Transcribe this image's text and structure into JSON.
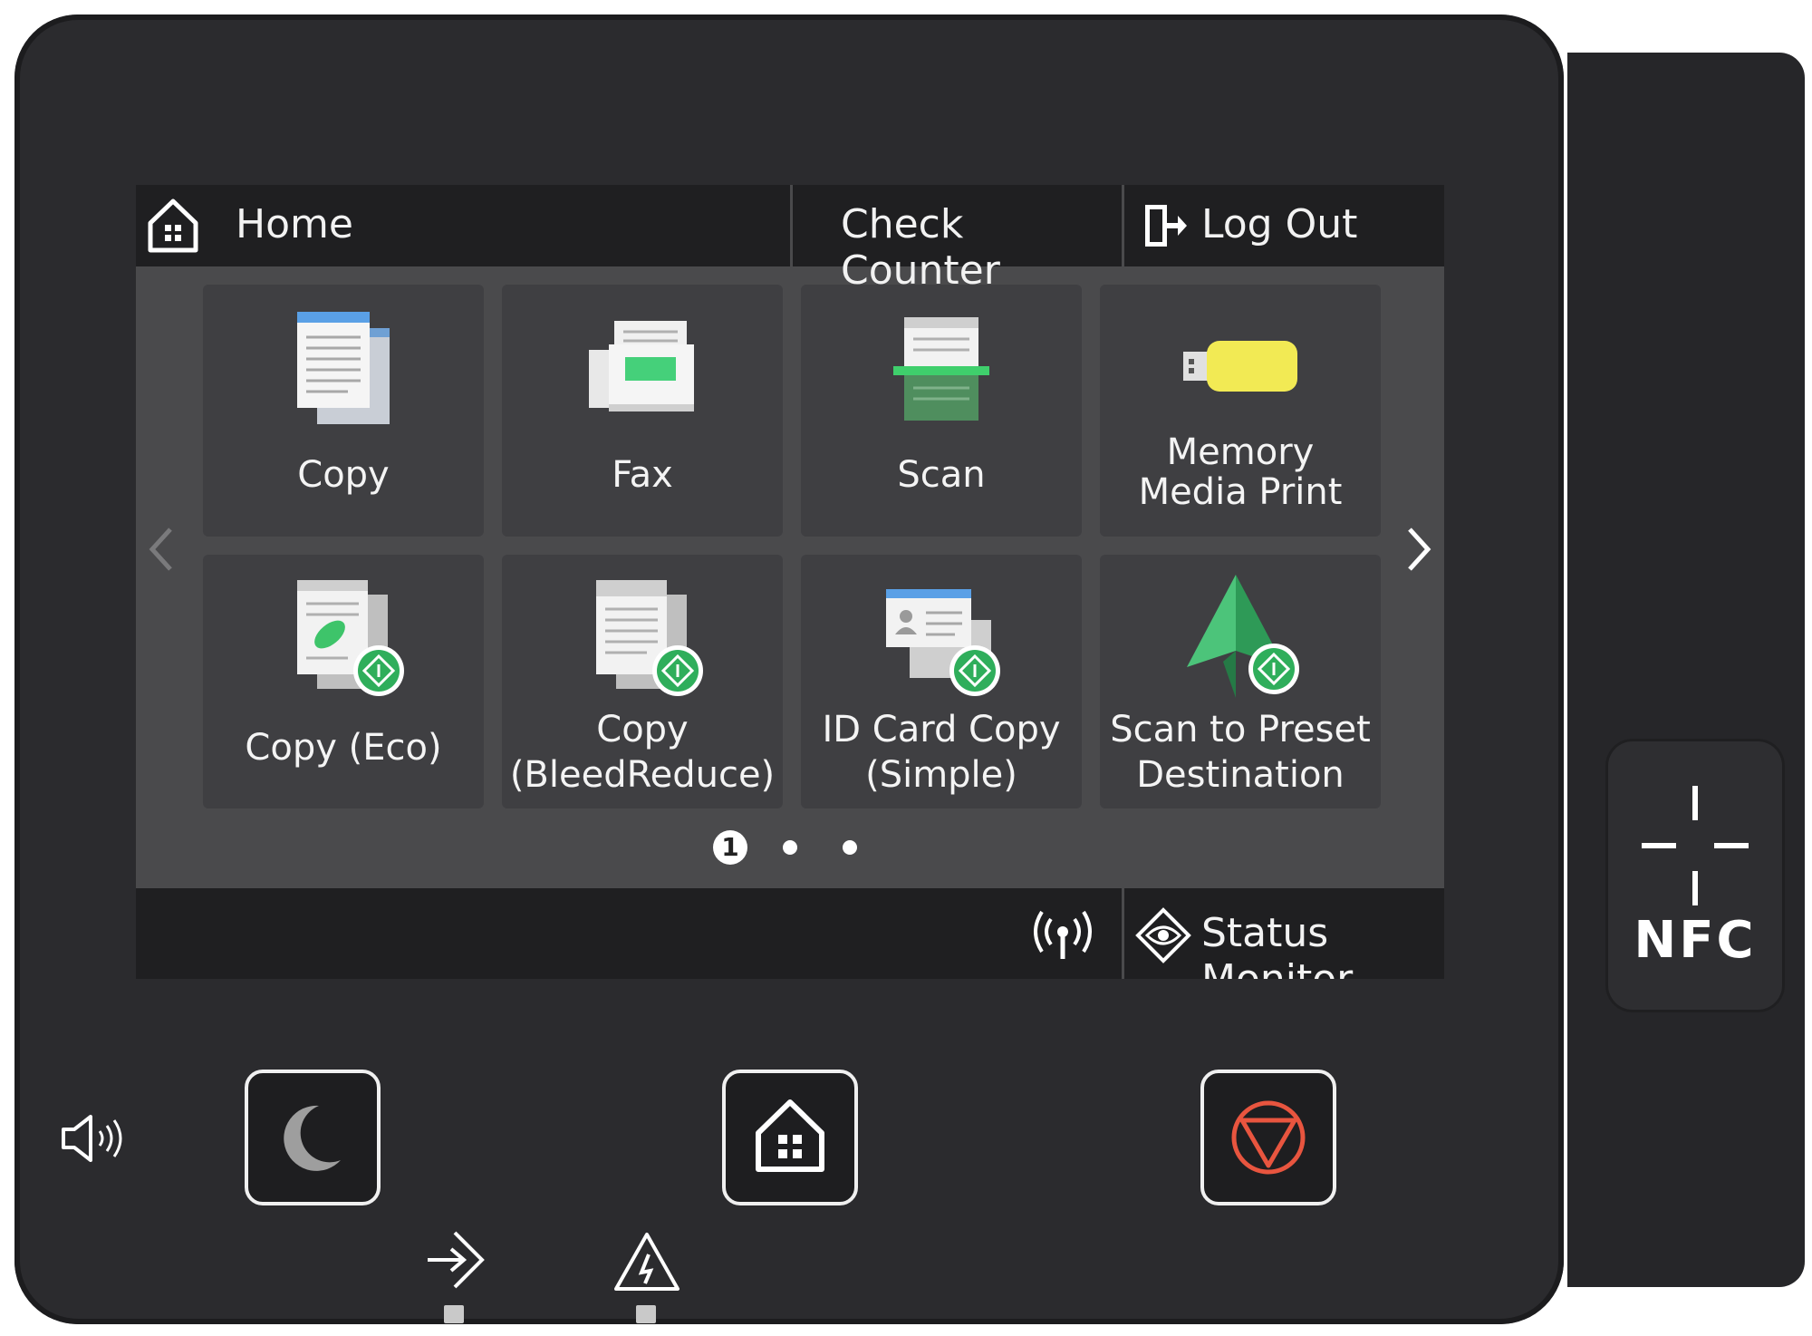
{
  "header": {
    "home_label": "Home",
    "check_counter_label": "Check Counter",
    "logout_label": "Log Out"
  },
  "tiles": [
    {
      "label": "Copy"
    },
    {
      "label": "Fax"
    },
    {
      "label": "Scan"
    },
    {
      "label_line1": "Memory",
      "label_line2": "Media Print"
    },
    {
      "label": "Copy (Eco)"
    },
    {
      "label_line1": "Copy",
      "label_line2": "(BleedReduce)"
    },
    {
      "label_line1": "ID Card Copy",
      "label_line2": "(Simple)"
    },
    {
      "label_line1": "Scan to Preset",
      "label_line2": "Destination"
    }
  ],
  "pagination": {
    "current": "1",
    "total_pages": 3
  },
  "footer": {
    "status_monitor_label": "Status Monitor"
  },
  "hardware": {
    "nfc_label": "NFC"
  },
  "colors": {
    "accent_green": "#2fae5b",
    "stop_red": "#e8553f",
    "screen_bg": "#4a4a4c"
  },
  "icons": [
    "home-icon",
    "logout-icon",
    "copy-icon",
    "fax-icon",
    "scan-icon",
    "usb-memory-icon",
    "eco-leaf-icon",
    "preset-badge-icon",
    "id-card-icon",
    "paper-plane-icon",
    "wireless-icon",
    "status-eye-icon",
    "sleep-moon-icon",
    "stop-icon",
    "volume-icon",
    "data-in-icon",
    "error-warning-icon",
    "nfc-icon"
  ]
}
